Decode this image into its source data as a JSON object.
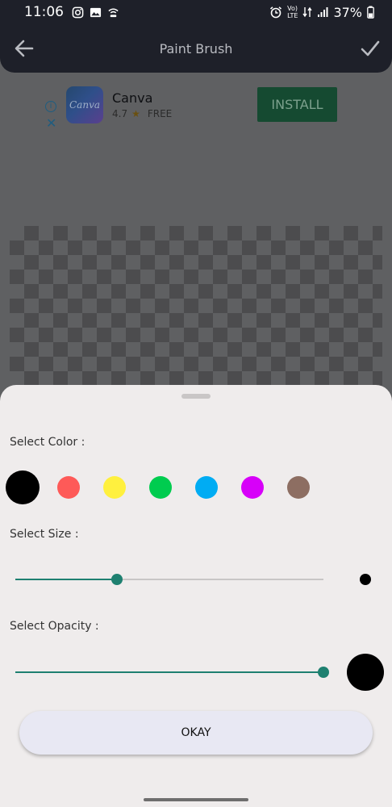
{
  "status_bar": {
    "time": "11:06",
    "network_label_top": "Vo)",
    "network_label_bottom": "LTE",
    "battery": "37%",
    "icons": [
      "instagram-icon",
      "gallery-icon",
      "wifi-calling-icon",
      "alarm-icon",
      "volte-icon",
      "data-icon",
      "signal-icon",
      "battery-icon"
    ]
  },
  "app_bar": {
    "title": "Paint Brush",
    "back_icon": "arrow-left-icon",
    "confirm_icon": "check-icon"
  },
  "ad": {
    "logo_text": "Canva",
    "app_name": "Canva",
    "rating": "4.7",
    "price": "FREE",
    "install_label": "INSTALL",
    "info_icon": "info-icon",
    "close_icon": "close-icon"
  },
  "sheet": {
    "color_label": "Select Color :",
    "size_label": "Select Size :",
    "opacity_label": "Select Opacity :",
    "okay_label": "OKAY",
    "colors": [
      "#000000",
      "#fe5a58",
      "#fff03e",
      "#00cc4f",
      "#00acf3",
      "#d700f9",
      "#8d6e62"
    ],
    "selected_color_index": 0,
    "size_value": 0.33,
    "opacity_value": 1.0,
    "accent": "#1e8070"
  }
}
